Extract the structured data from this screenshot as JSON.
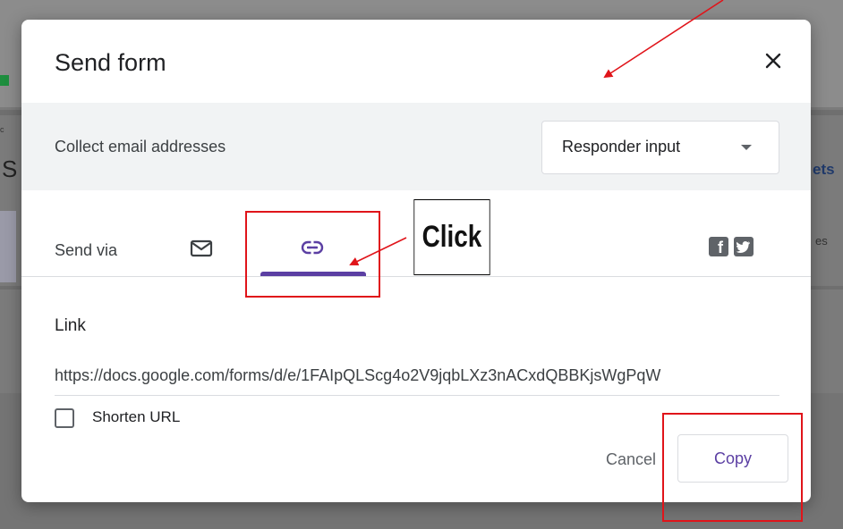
{
  "background": {
    "partial_s": "S",
    "partial_sheets": "ets",
    "partial_es": "es",
    "partial_c": "c"
  },
  "dialog": {
    "title": "Send form",
    "close_icon": "close-icon",
    "collect_email": {
      "label": "Collect email addresses",
      "selected": "Responder input"
    },
    "send_via": {
      "label": "Send via",
      "tabs": [
        {
          "icon": "email-icon",
          "active": false
        },
        {
          "icon": "link-icon",
          "active": true
        }
      ],
      "share": [
        "facebook-icon",
        "twitter-icon"
      ]
    },
    "link": {
      "label": "Link",
      "url": "https://docs.google.com/forms/d/e/1FAIpQLScg4o2V9jqbLXz3nACxdQBBKjsWgPqW"
    },
    "shorten_url": {
      "label": "Shorten URL",
      "checked": false
    },
    "buttons": {
      "cancel": "Cancel",
      "copy": "Copy"
    }
  },
  "annotation": {
    "callout_text": "Click",
    "highlight_color": "#e0141a"
  },
  "colors": {
    "accent": "#5b3fa3",
    "band": "#f1f3f4"
  }
}
